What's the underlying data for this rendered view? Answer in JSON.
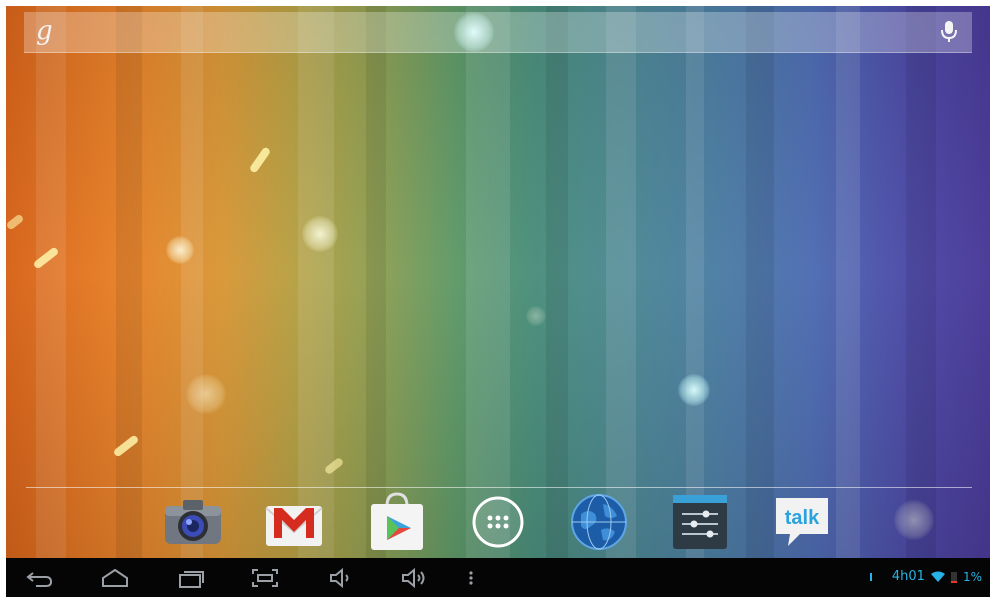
{
  "search": {
    "logo": "g"
  },
  "dock": {
    "apps": [
      {
        "icon": "camera-icon"
      },
      {
        "icon": "gmail-icon",
        "letter": "M"
      },
      {
        "icon": "play-store-icon"
      },
      {
        "icon": "app-drawer-icon"
      },
      {
        "icon": "browser-globe-icon"
      },
      {
        "icon": "settings-icon"
      },
      {
        "icon": "talk-icon",
        "label": "talk"
      }
    ]
  },
  "navigation": {
    "buttons": [
      "back-icon",
      "home-icon",
      "recent-apps-icon",
      "screenshot-icon",
      "volume-down-icon",
      "volume-up-icon",
      "menu-icon"
    ]
  },
  "status_bar": {
    "time": "4h01",
    "battery": "1%",
    "accent": "#27b3e6"
  }
}
